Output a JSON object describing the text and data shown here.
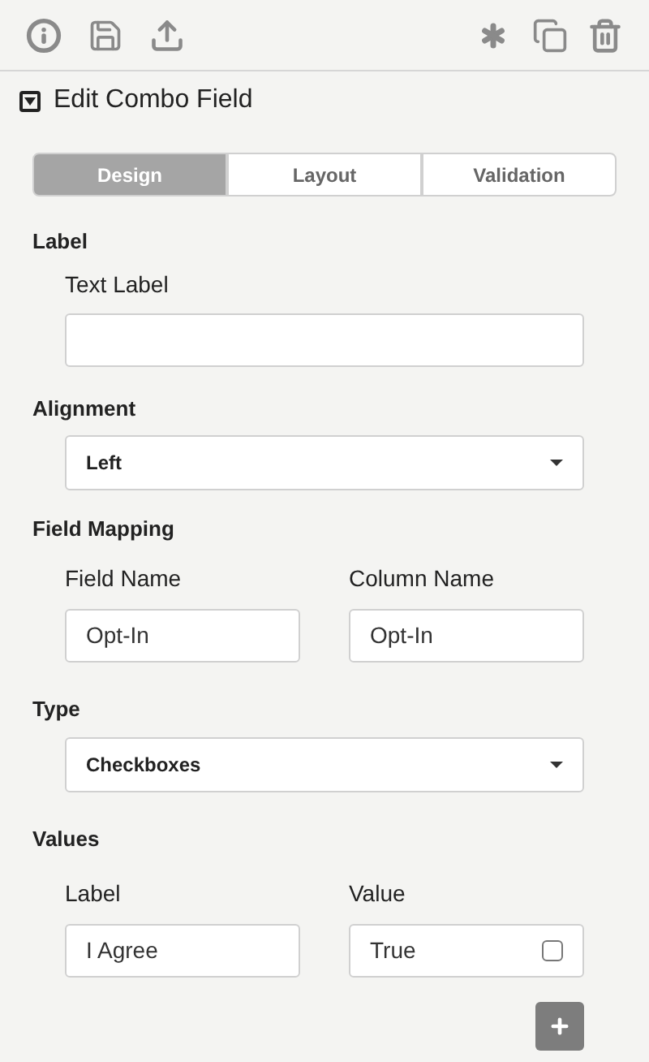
{
  "panel": {
    "title": "Edit Combo Field",
    "expanded": true
  },
  "tabs": [
    {
      "label": "Design",
      "selected": true
    },
    {
      "label": "Layout",
      "selected": false
    },
    {
      "label": "Validation",
      "selected": false
    }
  ],
  "label_section": {
    "heading": "Label",
    "field_label": "Text Label"
  },
  "alignment": {
    "heading": "Alignment",
    "value": "Left"
  },
  "field_mapping": {
    "heading": "Field Mapping",
    "field_name_label": "Field Name",
    "field_name": "Opt-In",
    "column_name_label": "Column Name",
    "column_name": "Opt-In"
  },
  "type": {
    "heading": "Type",
    "value": "Checkboxes"
  },
  "values": {
    "heading": "Values",
    "label_header": "Label",
    "value_header": "Value",
    "rows": [
      {
        "label": "I Agree",
        "value": "True",
        "checked": false
      }
    ]
  }
}
